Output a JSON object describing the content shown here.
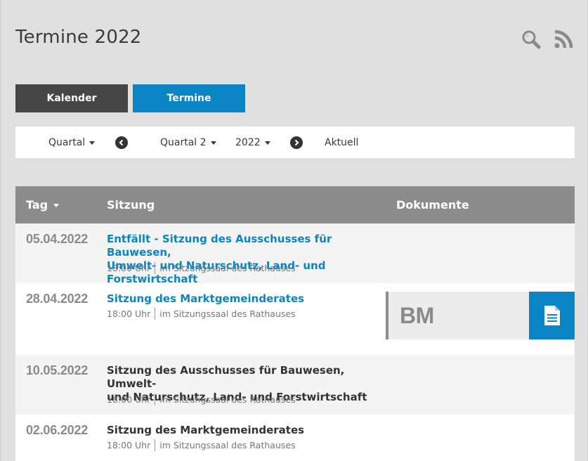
{
  "page": {
    "title": "Termine 2022"
  },
  "icons": {
    "search": "search-icon",
    "rss": "rss-icon"
  },
  "view_tabs": [
    {
      "label": "Kalender",
      "color": "#454545"
    },
    {
      "label": "Termine",
      "color": "#0b84c6"
    }
  ],
  "filters": {
    "period_type": "Quartal",
    "period": "Quartal 2",
    "year": "2022",
    "current": "Aktuell"
  },
  "table": {
    "headers": {
      "day": "Tag",
      "session": "Sitzung",
      "documents": "Dokumente"
    },
    "rows": [
      {
        "date": "05.04.2022",
        "title_line1": "Entfällt - Sitzung des Ausschusses für Bauwesen,",
        "title_line2": "Umwelt- und Naturschutz, Land- und Forstwirtschaft",
        "time": "18:00 Uhr",
        "place": "im Sitzungssaal des Rathauses",
        "link": true
      },
      {
        "date": "28.04.2022",
        "title_line1": "Sitzung des Marktgemeinderates",
        "time": "18:00 Uhr",
        "place": "im Sitzungssaal des Rathauses",
        "link": true,
        "document_label": "BM"
      },
      {
        "date": "10.05.2022",
        "title_line1": "Sitzung des Ausschusses für Bauwesen, Umwelt-",
        "title_line2": "und Naturschutz, Land- und Forstwirtschaft",
        "time": "18:00 Uhr",
        "place": "im Sitzungssaal des Rathauses",
        "link": false
      },
      {
        "date": "02.06.2022",
        "title_line1": "Sitzung des Marktgemeinderates",
        "time": "18:00 Uhr",
        "place": "im Sitzungssaal des Rathauses",
        "link": false
      }
    ]
  },
  "colors": {
    "accent": "#0b84c6",
    "dark_tab": "#454545",
    "header_bg": "#8c8c8c",
    "page_bg": "#e0e0e0"
  }
}
